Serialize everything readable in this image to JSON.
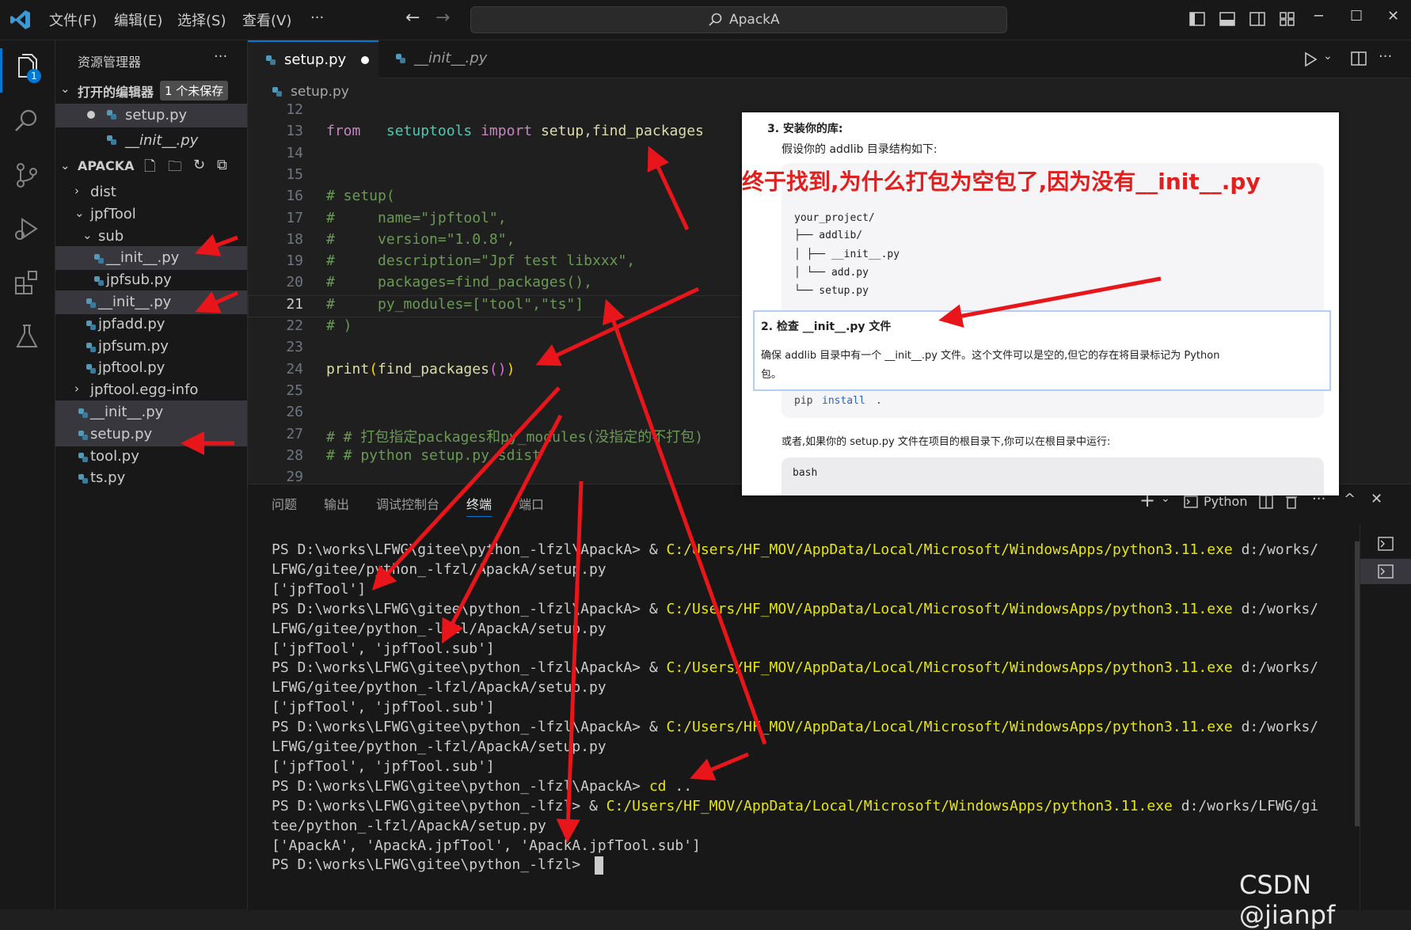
{
  "titlebar": {
    "menus": [
      "文件(F)",
      "编辑(E)",
      "选择(S)",
      "查看(V)",
      "···"
    ],
    "search_text": "ApackA"
  },
  "activity": {
    "explorer_badge": "1"
  },
  "sidebar": {
    "title": "资源管理器",
    "more": "···",
    "open_editors_label": "打开的编辑器",
    "unsaved_badge": "1 个未保存",
    "open_files": [
      "setup.py",
      "__init__.py"
    ],
    "project_label": "APACKA",
    "tree": [
      {
        "label": "dist",
        "indent": 1,
        "type": "folder",
        "open": false
      },
      {
        "label": "jpfTool",
        "indent": 1,
        "type": "folder",
        "open": true
      },
      {
        "label": "sub",
        "indent": 2,
        "type": "folder",
        "open": true
      },
      {
        "label": "__init__.py",
        "indent": 3,
        "type": "file",
        "selected": true
      },
      {
        "label": "jpfsub.py",
        "indent": 3,
        "type": "file"
      },
      {
        "label": "__init__.py",
        "indent": 2,
        "type": "file",
        "selected": true
      },
      {
        "label": "jpfadd.py",
        "indent": 2,
        "type": "file"
      },
      {
        "label": "jpfsum.py",
        "indent": 2,
        "type": "file"
      },
      {
        "label": "jpftool.py",
        "indent": 2,
        "type": "file"
      },
      {
        "label": "jpftool.egg-info",
        "indent": 1,
        "type": "folder",
        "open": false
      },
      {
        "label": "__init__.py",
        "indent": 1,
        "type": "file",
        "selected": true
      },
      {
        "label": "setup.py",
        "indent": 1,
        "type": "file",
        "selected": true
      },
      {
        "label": "tool.py",
        "indent": 1,
        "type": "file"
      },
      {
        "label": "ts.py",
        "indent": 1,
        "type": "file"
      }
    ]
  },
  "editor": {
    "tabs": [
      {
        "label": "setup.py",
        "active": true,
        "dirty": true
      },
      {
        "label": "__init__.py",
        "active": false
      }
    ],
    "breadcrumb": "setup.py",
    "current_line": "21",
    "lines": [
      {
        "n": "12",
        "t": ""
      },
      {
        "n": "13",
        "t": "from   setuptools import setup,find_packages"
      },
      {
        "n": "14",
        "t": ""
      },
      {
        "n": "15",
        "t": ""
      },
      {
        "n": "16",
        "t": "# setup("
      },
      {
        "n": "17",
        "t": "#     name=\"jpftool\","
      },
      {
        "n": "18",
        "t": "#     version=\"1.0.8\","
      },
      {
        "n": "19",
        "t": "#     description=\"Jpf test libxxx\","
      },
      {
        "n": "20",
        "t": "#     packages=find_packages(),"
      },
      {
        "n": "21",
        "t": "#     py_modules=[\"tool\",\"ts\"]"
      },
      {
        "n": "22",
        "t": "# )"
      },
      {
        "n": "23",
        "t": ""
      },
      {
        "n": "24",
        "t": "print(find_packages())"
      },
      {
        "n": "25",
        "t": ""
      },
      {
        "n": "26",
        "t": ""
      },
      {
        "n": "27",
        "t": "# # 打包指定packages和py_modules(没指定的不打包)"
      },
      {
        "n": "28",
        "t": "# # python setup.py sdist"
      },
      {
        "n": "29",
        "t": ""
      }
    ]
  },
  "panel": {
    "tabs": [
      "问题",
      "输出",
      "调试控制台",
      "终端",
      "端口"
    ],
    "active_tab": "终端",
    "shell_label": "Python",
    "terminal_lines": [
      "PS D:\\works\\LFWG\\gitee\\python_-lfzl\\ApackA> & C:/Users/HF_MOV/AppData/Local/Microsoft/WindowsApps/python3.11.exe d:/works/",
      "LFWG/gitee/python_-lfzl/ApackA/setup.py",
      "['jpfTool']",
      "PS D:\\works\\LFWG\\gitee\\python_-lfzl\\ApackA> & C:/Users/HF_MOV/AppData/Local/Microsoft/WindowsApps/python3.11.exe d:/works/",
      "LFWG/gitee/python_-lfzl/ApackA/setup.py",
      "['jpfTool', 'jpfTool.sub']",
      "PS D:\\works\\LFWG\\gitee\\python_-lfzl\\ApackA> & C:/Users/HF_MOV/AppData/Local/Microsoft/WindowsApps/python3.11.exe d:/works/",
      "LFWG/gitee/python_-lfzl/ApackA/setup.py",
      "['jpfTool', 'jpfTool.sub']",
      "PS D:\\works\\LFWG\\gitee\\python_-lfzl\\ApackA> & C:/Users/HF_MOV/AppData/Local/Microsoft/WindowsApps/python3.11.exe d:/works/",
      "LFWG/gitee/python_-lfzl/ApackA/setup.py",
      "['jpfTool', 'jpfTool.sub']",
      "PS D:\\works\\LFWG\\gitee\\python_-lfzl\\ApackA> cd ..",
      "PS D:\\works\\LFWG\\gitee\\python_-lfzl> & C:/Users/HF_MOV/AppData/Local/Microsoft/WindowsApps/python3.11.exe d:/works/LFWG/gi",
      "tee/python_-lfzl/ApackA/setup.py",
      "['ApackA', 'ApackA.jpfTool', 'ApackA.jpfTool.sub']",
      "PS D:\\works\\LFWG\\gitee\\python_-lfzl> "
    ]
  },
  "overlay": {
    "step3": "3. 安装你的库:",
    "intro": "假设你的 addlib 目录结构如下:",
    "banner": "终于找到,为什么打包为空包了,因为没有__init__.py",
    "tree_lines": [
      "your_project/",
      "├── addlib/",
      "│   ├── __init__.py",
      "│   └── add.py",
      "└── setup.py"
    ],
    "step2_title": "2. 检查 __init__.py 文件",
    "step2_body1": "确保 addlib 目录中有一个 __init__.py 文件。这个文件可以是空的,但它的存在将目录标记为 Python",
    "step2_body2": "包。",
    "pip_cmd": "pip",
    "pip_install": "install",
    "pip_dot": ".",
    "or_text": "或者,如果你的 setup.py 文件在项目的根目录下,你可以在根目录中运行:",
    "bash": "bash"
  },
  "watermark": "CSDN @jianpf",
  "colors": {
    "arrow": "#e8151b",
    "keyword": "#c586c0",
    "comment": "#6a9955",
    "string": "#ce9178",
    "func": "#dcdcaa",
    "module": "#4ec9b0",
    "yellow": "#e5e510"
  }
}
